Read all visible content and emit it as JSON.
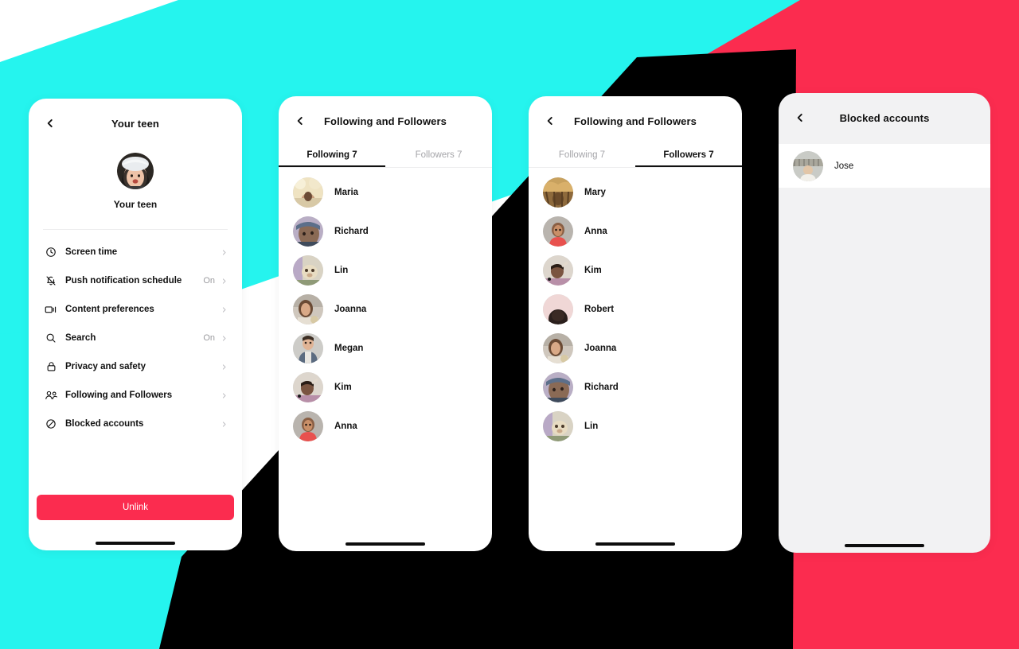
{
  "theme": {
    "cyan": "#25F4EE",
    "red": "#FB2C4F",
    "black": "#000000",
    "white": "#FFFFFF",
    "grey_screen": "#F2F2F3",
    "text_primary": "#111111",
    "text_muted": "#9B9B9F"
  },
  "screens": [
    {
      "id": "your-teen",
      "nav": {
        "back_icon": "chevron-left-icon",
        "title": "Your teen"
      },
      "profile": {
        "avatar_icon": "teen-avatar",
        "name": "Your teen"
      },
      "menu": [
        {
          "icon": "clock-icon",
          "label": "Screen time",
          "value": ""
        },
        {
          "icon": "bell-off-icon",
          "label": "Push notification schedule",
          "value": "On"
        },
        {
          "icon": "video-icon",
          "label": "Content preferences",
          "value": ""
        },
        {
          "icon": "search-icon",
          "label": "Search",
          "value": "On"
        },
        {
          "icon": "lock-icon",
          "label": "Privacy and safety",
          "value": ""
        },
        {
          "icon": "people-icon",
          "label": "Following and Followers",
          "value": ""
        },
        {
          "icon": "block-icon",
          "label": "Blocked accounts",
          "value": ""
        }
      ],
      "unlink_label": "Unlink"
    },
    {
      "id": "following",
      "nav": {
        "back_icon": "chevron-left-icon",
        "title": "Following and Followers"
      },
      "tabs": [
        {
          "label": "Following 7",
          "active": true
        },
        {
          "label": "Followers 7",
          "active": false
        }
      ],
      "users": [
        {
          "name": "Maria",
          "avatar": "avatar-maria"
        },
        {
          "name": "Richard",
          "avatar": "avatar-richard"
        },
        {
          "name": "Lin",
          "avatar": "avatar-lin"
        },
        {
          "name": "Joanna",
          "avatar": "avatar-joanna"
        },
        {
          "name": "Megan",
          "avatar": "avatar-megan"
        },
        {
          "name": "Kim",
          "avatar": "avatar-kim"
        },
        {
          "name": "Anna",
          "avatar": "avatar-anna"
        }
      ]
    },
    {
      "id": "followers",
      "nav": {
        "back_icon": "chevron-left-icon",
        "title": "Following and Followers"
      },
      "tabs": [
        {
          "label": "Following 7",
          "active": false
        },
        {
          "label": "Followers 7",
          "active": true
        }
      ],
      "users": [
        {
          "name": "Mary",
          "avatar": "avatar-mary"
        },
        {
          "name": "Anna",
          "avatar": "avatar-anna"
        },
        {
          "name": "Kim",
          "avatar": "avatar-kim"
        },
        {
          "name": "Robert",
          "avatar": "avatar-robert"
        },
        {
          "name": "Joanna",
          "avatar": "avatar-joanna"
        },
        {
          "name": "Richard",
          "avatar": "avatar-richard"
        },
        {
          "name": "Lin",
          "avatar": "avatar-lin"
        }
      ]
    },
    {
      "id": "blocked",
      "nav": {
        "back_icon": "chevron-left-icon",
        "title": "Blocked accounts"
      },
      "users": [
        {
          "name": "Jose",
          "avatar": "avatar-jose"
        }
      ]
    }
  ]
}
